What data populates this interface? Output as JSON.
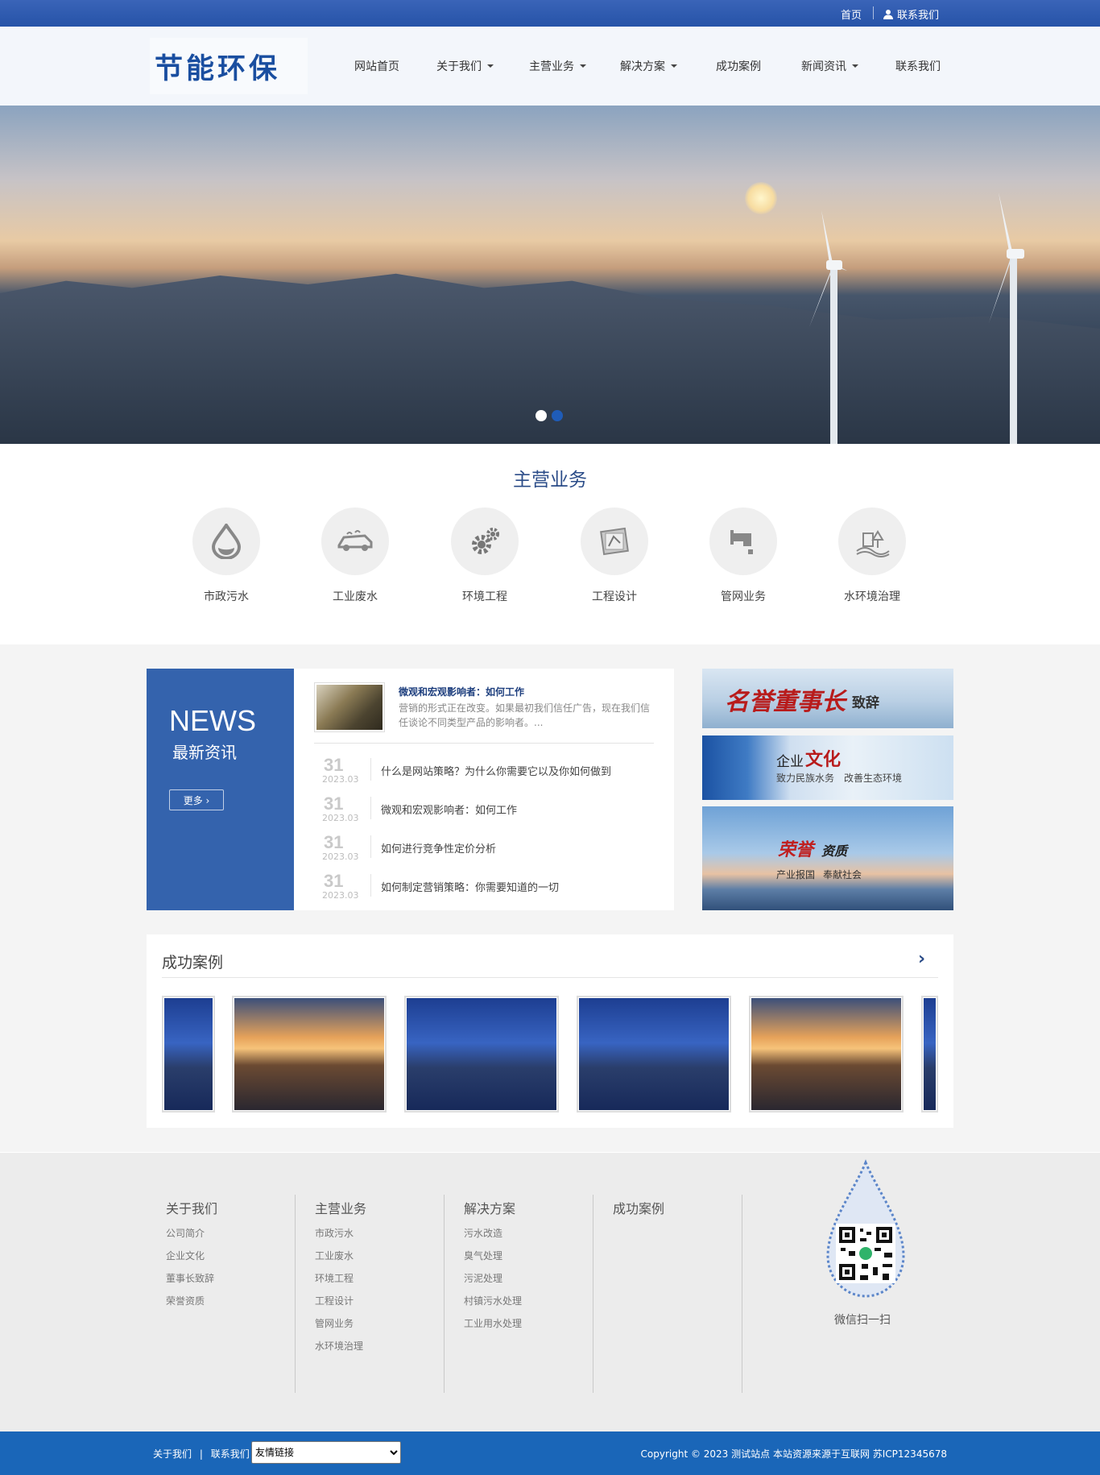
{
  "topbar": {
    "home": "首页",
    "contact": "联系我们"
  },
  "logo": {
    "text": "节能环保"
  },
  "nav": [
    {
      "label": "网站首页",
      "dropdown": false
    },
    {
      "label": "关于我们",
      "dropdown": true
    },
    {
      "label": "主营业务",
      "dropdown": true
    },
    {
      "label": "解决方案",
      "dropdown": true
    },
    {
      "label": "成功案例",
      "dropdown": false
    },
    {
      "label": "新闻资讯",
      "dropdown": true
    },
    {
      "label": "联系我们",
      "dropdown": false
    }
  ],
  "banner": {
    "slides": 2,
    "active": 0
  },
  "business": {
    "title": "主营业务",
    "items": [
      {
        "label": "市政污水",
        "icon": "water-drop-icon"
      },
      {
        "label": "工业废水",
        "icon": "car-wash-icon"
      },
      {
        "label": "环境工程",
        "icon": "gears-icon"
      },
      {
        "label": "工程设计",
        "icon": "design-board-icon"
      },
      {
        "label": "管网业务",
        "icon": "pipe-icon"
      },
      {
        "label": "水环境治理",
        "icon": "landscape-icon"
      }
    ]
  },
  "news": {
    "en_title": "NEWS",
    "cn_title": "最新资讯",
    "more": "更多 ›",
    "featured": {
      "title": "微观和宏观影响者：如何工作",
      "desc": "营销的形式正在改变。如果最初我们信任广告，现在我们信任谈论不同类型产品的影响者。..."
    },
    "list": [
      {
        "day": "31",
        "ym": "2023.03",
        "title": "什么是网站策略？为什么你需要它以及你如何做到"
      },
      {
        "day": "31",
        "ym": "2023.03",
        "title": "微观和宏观影响者：如何工作"
      },
      {
        "day": "31",
        "ym": "2023.03",
        "title": "如何进行竞争性定价分析"
      },
      {
        "day": "31",
        "ym": "2023.03",
        "title": "如何制定营销策略：你需要知道的一切"
      }
    ]
  },
  "side_banners": {
    "b1": {
      "big": "名誉董事长",
      "small": "致辞"
    },
    "b2": {
      "a": "企业",
      "b": "文化",
      "sub1": "致力民族水务",
      "sub2": "改善生态环境"
    },
    "b3": {
      "a": "荣誉",
      "b": "资质",
      "sub1": "产业报国",
      "sub2": "奉献社会"
    }
  },
  "cases": {
    "title": "成功案例",
    "next": "›"
  },
  "footer": {
    "columns": [
      {
        "heading": "关于我们",
        "links": [
          "公司简介",
          "企业文化",
          "董事长致辞",
          "荣誉资质"
        ]
      },
      {
        "heading": "主营业务",
        "links": [
          "市政污水",
          "工业废水",
          "环境工程",
          "工程设计",
          "管网业务",
          "水环境治理"
        ]
      },
      {
        "heading": "解决方案",
        "links": [
          "污水改造",
          "臭气处理",
          "污泥处理",
          "村镇污水处理",
          "工业用水处理"
        ]
      },
      {
        "heading": "成功案例",
        "links": []
      }
    ],
    "qr_label": "微信扫一扫"
  },
  "bottombar": {
    "about": "关于我们",
    "divider": "|",
    "contact": "联系我们",
    "select_value": "友情链接",
    "copyright": "Copyright © 2023 测试站点 本站资源来源于互联网 苏ICP12345678"
  },
  "colors": {
    "brand": "#2653a8",
    "news_blue": "#3463ad",
    "bottom_blue": "#1a66b8"
  }
}
